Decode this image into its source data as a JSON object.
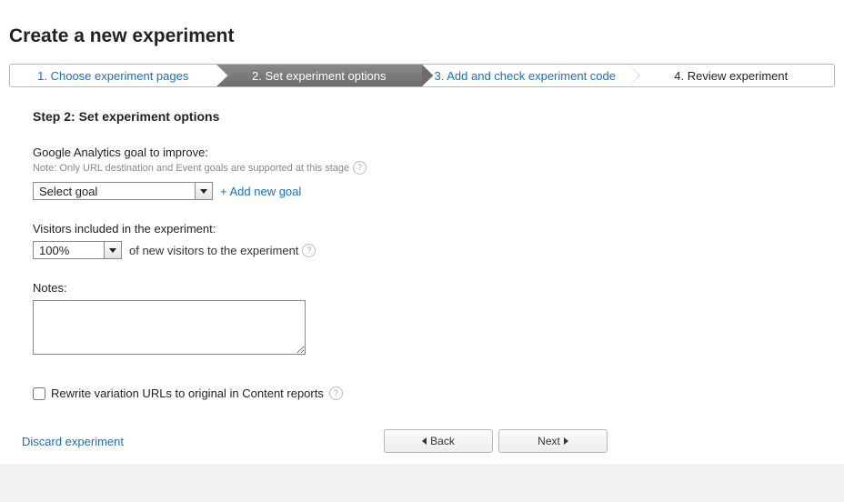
{
  "page_title": "Create a new experiment",
  "stepper": {
    "steps": [
      {
        "label": "1. Choose experiment pages"
      },
      {
        "label": "2. Set experiment options"
      },
      {
        "label": "3. Add and check experiment code"
      },
      {
        "label": "4. Review experiment"
      }
    ],
    "active_index": 1
  },
  "heading": "Step 2: Set experiment options",
  "goal": {
    "label": "Google Analytics goal to improve:",
    "note": "Note: Only URL destination and Event goals are supported at this stage",
    "selected": "Select goal",
    "add_link": "+ Add new goal"
  },
  "visitors": {
    "label": "Visitors included in the experiment:",
    "selected": "100%",
    "description": "of new visitors to the experiment"
  },
  "notes": {
    "label": "Notes:",
    "value": ""
  },
  "rewrite": {
    "checked": false,
    "label": "Rewrite variation URLs to original in Content reports"
  },
  "actions": {
    "discard": "Discard experiment",
    "back": "Back",
    "next": "Next"
  }
}
